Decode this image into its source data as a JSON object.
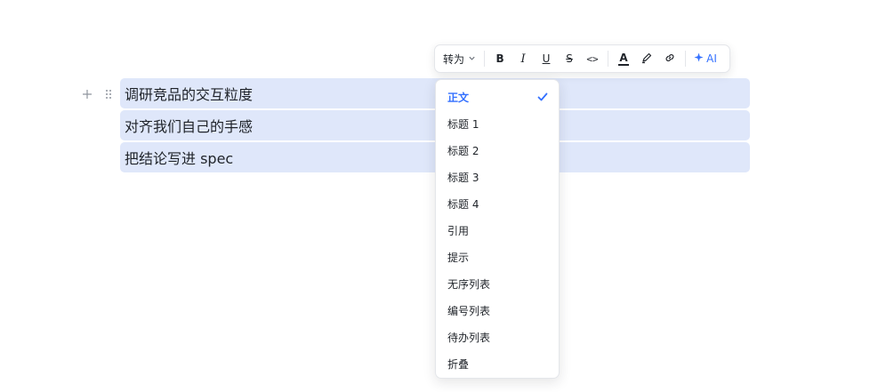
{
  "editor": {
    "blocks": [
      {
        "text": "调研竞品的交互粒度"
      },
      {
        "text": "对齐我们自己的手感"
      },
      {
        "text": "把结论写进 spec"
      }
    ],
    "icons": {
      "add": "plus-icon",
      "drag": "drag-handle-icon"
    }
  },
  "toolbar": {
    "turn_into_label": "转为",
    "bold_label": "B",
    "italic_label": "I",
    "underline_label": "U",
    "strike_label": "S",
    "code_label": "<>",
    "text_color_label": "A",
    "ai_label": "AI",
    "icons": {
      "chevron": "chevron-down-icon",
      "highlight": "highlighter-icon",
      "link": "link-icon",
      "ai": "sparkle-icon"
    }
  },
  "menu": {
    "items": [
      {
        "label": "正文",
        "selected": true
      },
      {
        "label": "标题 1"
      },
      {
        "label": "标题 2"
      },
      {
        "label": "标题 3"
      },
      {
        "label": "标题 4"
      },
      {
        "label": "引用"
      },
      {
        "label": "提示"
      },
      {
        "label": "无序列表"
      },
      {
        "label": "编号列表"
      },
      {
        "label": "待办列表"
      },
      {
        "label": "折叠"
      }
    ]
  },
  "colors": {
    "accent": "#3370ff",
    "selection": "#dfe7fa",
    "text": "#1f2329",
    "icon_gray": "#8f959e"
  }
}
